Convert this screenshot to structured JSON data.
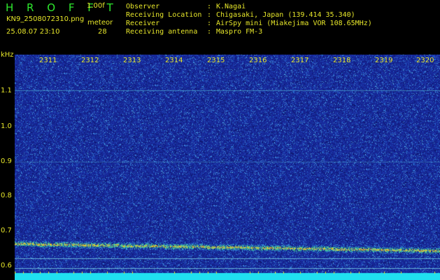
{
  "header": {
    "logo": "H R O F F T",
    "version": "1.00f",
    "filename": "KN9_2508072310.png",
    "meteor_label": "meteor",
    "datetime": "25.08.07 23:10",
    "meteor_count": "28"
  },
  "station_info": [
    {
      "key": "Observer",
      "value": "K.Nagai"
    },
    {
      "key": "Receiving Location",
      "value": "Chigasaki, Japan (139.414 35.340)"
    },
    {
      "key": "Receiver",
      "value": "AirSpy mini (Miakejima VOR 108.65MHz)"
    },
    {
      "key": "Receiving antenna",
      "value": "Maspro FM-3"
    }
  ],
  "separator": ":",
  "spectrogram": {
    "y_unit": "kHz",
    "y_ticks": [
      "1.1",
      "1.0",
      "0.9",
      "0.8",
      "0.7",
      "0.6"
    ],
    "time_ticks": [
      "2311",
      "2312",
      "2313",
      "2314",
      "2315",
      "2316",
      "2317",
      "2318",
      "2319",
      "2320"
    ],
    "colors": {
      "background": "#1a2a9a",
      "noise_hi": "#4aa0e0",
      "signal": "#e0c030",
      "bottom_band": "#20e0f0",
      "label": "#e6e62a"
    }
  }
}
